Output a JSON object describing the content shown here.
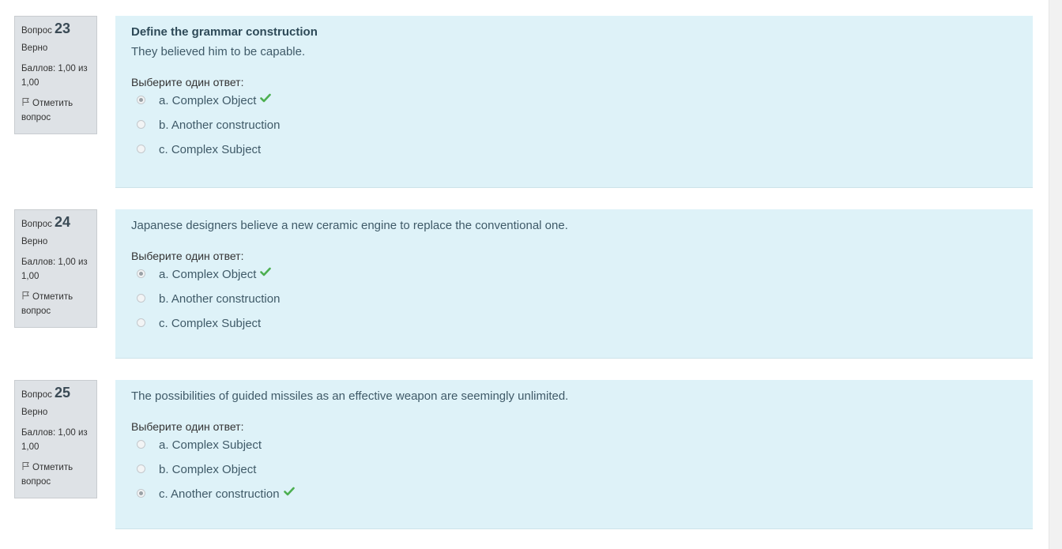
{
  "questions": [
    {
      "label": "Вопрос",
      "number": "23",
      "state": "Верно",
      "grade": "Баллов: 1,00 из 1,00",
      "flag": "Отметить вопрос",
      "title": "Define the grammar construction",
      "text": "They believed him to be capable.",
      "prompt": "Выберите один ответ:",
      "options": [
        {
          "label": "a. Complex Object",
          "checked": true,
          "correct": true
        },
        {
          "label": "b. Another construction",
          "checked": false,
          "correct": false
        },
        {
          "label": "c. Complex Subject",
          "checked": false,
          "correct": false
        }
      ]
    },
    {
      "label": "Вопрос",
      "number": "24",
      "state": "Верно",
      "grade": "Баллов: 1,00 из 1,00",
      "flag": "Отметить вопрос",
      "title": "",
      "text": "Japanese designers believe a new ceramic engine to replace the conventional one.",
      "prompt": "Выберите один ответ:",
      "options": [
        {
          "label": "a. Complex Object",
          "checked": true,
          "correct": true
        },
        {
          "label": "b. Another construction",
          "checked": false,
          "correct": false
        },
        {
          "label": "c. Complex Subject",
          "checked": false,
          "correct": false
        }
      ]
    },
    {
      "label": "Вопрос",
      "number": "25",
      "state": "Верно",
      "grade": "Баллов: 1,00 из 1,00",
      "flag": "Отметить вопрос",
      "title": "",
      "text": "The possibilities of guided missiles as an effective weapon are seemingly unlimited.",
      "prompt": "Выберите один ответ:",
      "options": [
        {
          "label": "a. Complex Subject",
          "checked": false,
          "correct": false
        },
        {
          "label": "b. Complex Object",
          "checked": false,
          "correct": false
        },
        {
          "label": "c. Another construction",
          "checked": true,
          "correct": true
        }
      ]
    }
  ],
  "icons": {
    "flag": "flag-icon",
    "correct": "check-icon"
  },
  "colors": {
    "content_bg": "#def2f8",
    "info_bg": "#dee2e6",
    "correct": "#4caf50"
  }
}
